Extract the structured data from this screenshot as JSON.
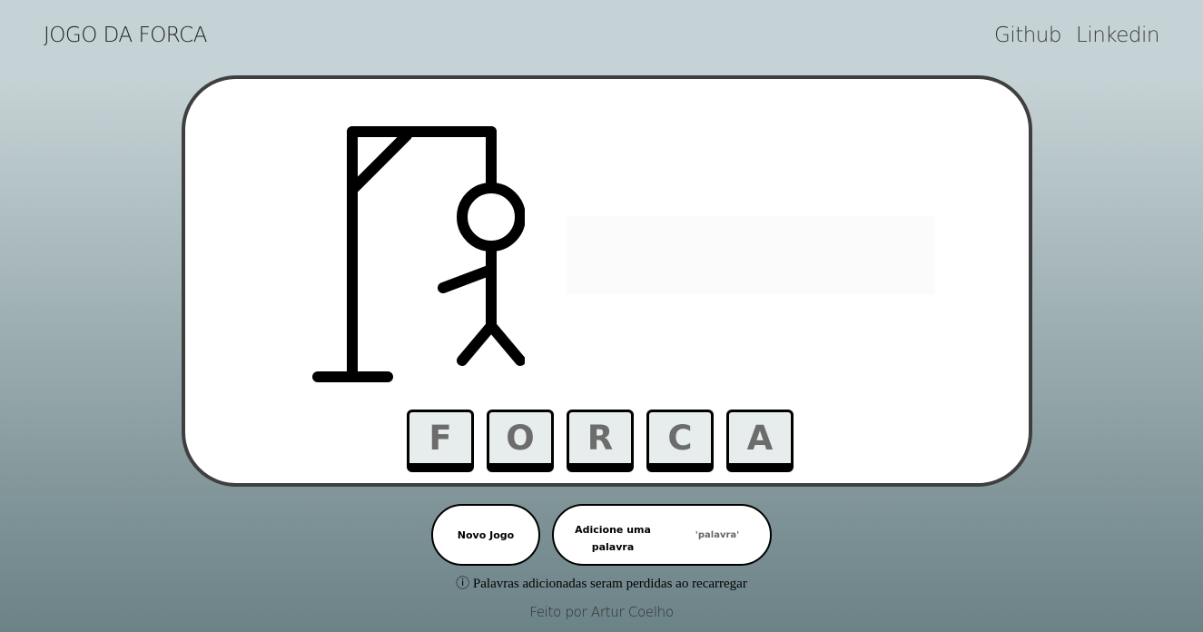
{
  "header": {
    "title": "JOGO DA FORCA",
    "links": [
      "Github",
      "Linkedin"
    ]
  },
  "game": {
    "drawing_icon": "hangman-icon",
    "word_letters": [
      "F",
      "O",
      "R",
      "C",
      "A"
    ]
  },
  "actions": {
    "new_game_label": "Novo Jogo",
    "add_word_label": "Adicione uma palavra",
    "add_word_hint": "'palavra'"
  },
  "notice": "ⓘ Palavras adicionadas seram perdidas ao recarregar",
  "footer": "Feito por Artur Coelho",
  "colors": {
    "board_background": "#ffffff",
    "board_border": "#3f3f3f",
    "tile_background": "#e7ecec",
    "tile_text": "#6c6c6c"
  }
}
